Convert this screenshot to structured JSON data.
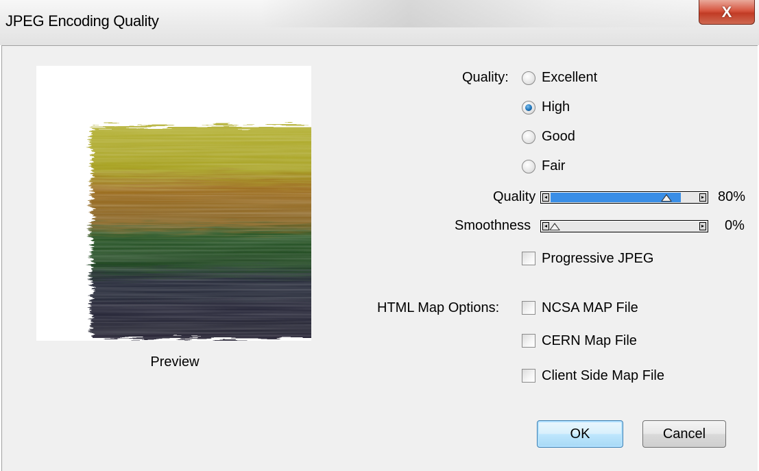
{
  "window": {
    "title": "JPEG Encoding Quality",
    "close_glyph": "X"
  },
  "preview": {
    "label": "Preview"
  },
  "quality_preset": {
    "label": "Quality:",
    "options": [
      "Excellent",
      "High",
      "Good",
      "Fair"
    ],
    "selected": "High"
  },
  "sliders": {
    "quality": {
      "label": "Quality",
      "value_text": "80%",
      "value": 0.8
    },
    "smoothness": {
      "label": "Smoothness",
      "value_text": "0%",
      "value": 0.0
    }
  },
  "progressive": {
    "label": "Progressive JPEG",
    "checked": false
  },
  "map_options": {
    "label": "HTML Map Options:",
    "items": [
      {
        "label": "NCSA MAP File",
        "checked": false
      },
      {
        "label": "CERN Map File",
        "checked": false
      },
      {
        "label": "Client Side Map File",
        "checked": false
      }
    ]
  },
  "buttons": {
    "ok": "OK",
    "cancel": "Cancel"
  },
  "colors": {
    "slider_fill": "#3a8ee6",
    "radio_selected": "#1d72b8",
    "close_button": "#c13b25"
  },
  "icons": {
    "close": "close-icon",
    "slider_left": "arrow-left-icon",
    "slider_right": "arrow-right-icon"
  }
}
